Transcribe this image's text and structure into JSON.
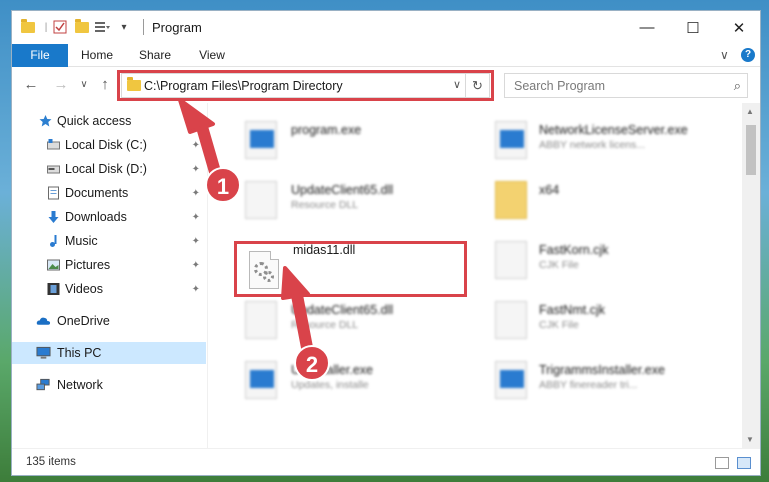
{
  "window": {
    "title": "Program",
    "minimize": "—",
    "maximize": "☐",
    "close": "✕"
  },
  "ribbon": {
    "tabs": [
      "File",
      "Home",
      "Share",
      "View"
    ],
    "expand_icon": "∨",
    "help": "?"
  },
  "nav": {
    "back": "←",
    "forward": "→",
    "recent": "∨",
    "up": "↑",
    "address": "C:\\Program Files\\Program Directory",
    "address_dropdown": "∨",
    "refresh": "↻",
    "search_placeholder": "Search Program",
    "search_icon": "⌕"
  },
  "sidebar": {
    "items": [
      {
        "label": "Quick access",
        "icon": "star-icon"
      },
      {
        "label": "Local Disk (C:)",
        "icon": "drive-icon",
        "pinned": true
      },
      {
        "label": "Local Disk (D:)",
        "icon": "drive-icon",
        "pinned": true
      },
      {
        "label": "Documents",
        "icon": "documents-icon",
        "pinned": true
      },
      {
        "label": "Downloads",
        "icon": "downloads-icon",
        "pinned": true
      },
      {
        "label": "Music",
        "icon": "music-icon",
        "pinned": true
      },
      {
        "label": "Pictures",
        "icon": "pictures-icon",
        "pinned": true
      },
      {
        "label": "Videos",
        "icon": "videos-icon",
        "pinned": true
      },
      {
        "label": "OneDrive",
        "icon": "cloud-icon"
      },
      {
        "label": "This PC",
        "icon": "computer-icon",
        "selected": true
      },
      {
        "label": "Network",
        "icon": "network-icon"
      }
    ],
    "pin_glyph": "📌"
  },
  "files": {
    "highlighted": {
      "name": "midas11.dll"
    },
    "blurred": [
      {
        "name": "program.exe",
        "sub": ""
      },
      {
        "name": "NetworkLicenseServer.exe",
        "sub": "ABBY network licens..."
      },
      {
        "name": "UpdateClient65.dll",
        "sub": "Resource DLL"
      },
      {
        "name": "x64",
        "sub": ""
      },
      {
        "name": "FastKorn.cjk",
        "sub": "CJK File"
      },
      {
        "name": "UpdateClient65.dll",
        "sub": "Resource DLL"
      },
      {
        "name": "FastNmt.cjk",
        "sub": "CJK File"
      },
      {
        "name": "Uninstaller.exe",
        "sub": "Updates, installe"
      },
      {
        "name": "TrigrammsInstaller.exe",
        "sub": "ABBY finereader tri..."
      }
    ]
  },
  "status": {
    "item_count": "135 items"
  },
  "annotations": {
    "badge1": "1",
    "badge2": "2",
    "accent_color": "#d9434a"
  },
  "colors": {
    "file_tab": "#1979ca",
    "selection": "#cce8ff"
  }
}
